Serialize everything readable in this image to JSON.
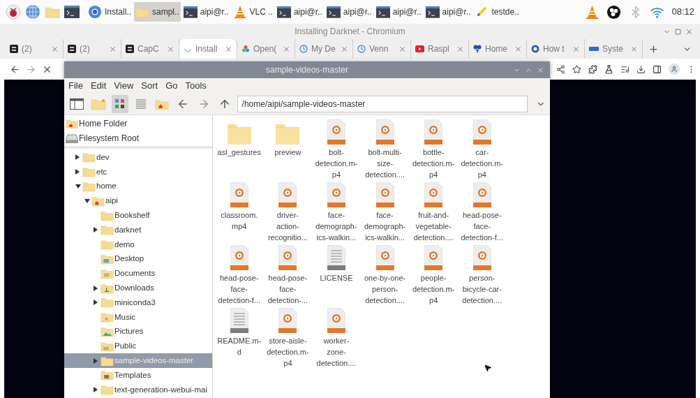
{
  "taskbar": {
    "launchers": [
      {
        "kind": "raspberry"
      },
      {
        "kind": "globe"
      },
      {
        "kind": "folder"
      },
      {
        "kind": "terminal"
      }
    ],
    "tasks": [
      {
        "kind": "chromium",
        "label": "Install..",
        "selected": false
      },
      {
        "kind": "folder",
        "label": "sampl..",
        "selected": true
      },
      {
        "kind": "terminal",
        "label": "aipi@r..",
        "selected": false
      },
      {
        "kind": "vlc",
        "label": "VLC ..",
        "selected": false
      },
      {
        "kind": "terminal",
        "label": "aipi@r..",
        "selected": false
      },
      {
        "kind": "terminal",
        "label": "aipi@r..",
        "selected": false
      },
      {
        "kind": "terminal",
        "label": "aipi@r..",
        "selected": false
      },
      {
        "kind": "terminal",
        "label": "aipi@r..",
        "selected": false
      },
      {
        "kind": "editor",
        "label": "testde..",
        "selected": false
      }
    ],
    "tray": [
      {
        "kind": "vlc"
      },
      {
        "kind": "obs"
      },
      {
        "kind": "bluetooth"
      },
      {
        "kind": "wifi"
      }
    ],
    "clock": "08:12"
  },
  "browser": {
    "title": "Installing Darknet - Chromium",
    "tabs": [
      {
        "kind": "capcut",
        "label": "(2)",
        "selected": false
      },
      {
        "kind": "capcut",
        "label": "(2)",
        "selected": false
      },
      {
        "kind": "capcut",
        "label": "CapC",
        "selected": false
      },
      {
        "kind": "loading",
        "label": "Install",
        "selected": true
      },
      {
        "kind": "colorful",
        "label": "Open(",
        "selected": false
      },
      {
        "kind": "clock",
        "label": "My De",
        "selected": false
      },
      {
        "kind": "clock",
        "label": "Venn",
        "selected": false
      },
      {
        "kind": "video",
        "label": "Raspl",
        "selected": false
      },
      {
        "kind": "shape",
        "label": "Home",
        "selected": false
      },
      {
        "kind": "gear",
        "label": "How t",
        "selected": false
      },
      {
        "kind": "chip",
        "label": "Syste",
        "selected": false
      }
    ]
  },
  "file_manager": {
    "title": "sample-videos-master",
    "menu": [
      "File",
      "Edit",
      "View",
      "Sort",
      "Go",
      "Tools"
    ],
    "toolbar": [
      {
        "kind": "sidepane",
        "selected": false
      },
      {
        "kind": "newfolder",
        "selected": false
      },
      {
        "kind": "icons",
        "selected": true
      },
      {
        "kind": "list",
        "selected": false
      },
      {
        "kind": "home",
        "selected": false
      },
      {
        "kind": "back",
        "selected": false
      },
      {
        "kind": "forward",
        "selected": false
      },
      {
        "kind": "up",
        "selected": false
      }
    ],
    "path": "/home/aipi/sample-videos-master",
    "places": [
      {
        "kind": "home",
        "label": "Home Folder"
      },
      {
        "kind": "drive",
        "label": "Filesystem Root"
      }
    ],
    "tree": [
      {
        "label": "dev",
        "kind": "folder",
        "expanded": false,
        "selected": false
      },
      {
        "label": "etc",
        "kind": "folder",
        "expanded": false,
        "selected": false
      },
      {
        "label": "home",
        "kind": "folder",
        "expanded": true,
        "selected": false,
        "children": [
          {
            "label": "aipi",
            "kind": "home",
            "expanded": true,
            "selected": false,
            "children": [
              {
                "label": "Bookshelf",
                "kind": "folder",
                "selected": false
              },
              {
                "label": "darknet",
                "kind": "folder",
                "expanded": false,
                "selected": false
              },
              {
                "label": "demo",
                "kind": "folder",
                "selected": false
              },
              {
                "label": "Desktop",
                "kind": "desktop",
                "selected": false
              },
              {
                "label": "Documents",
                "kind": "documents",
                "selected": false
              },
              {
                "label": "Downloads",
                "kind": "downloads",
                "expanded": false,
                "selected": false
              },
              {
                "label": "miniconda3",
                "kind": "folder",
                "expanded": false,
                "selected": false
              },
              {
                "label": "Music",
                "kind": "music",
                "selected": false
              },
              {
                "label": "Pictures",
                "kind": "pictures",
                "selected": false
              },
              {
                "label": "Public",
                "kind": "public",
                "selected": false
              },
              {
                "label": "sample-videos-master",
                "kind": "folder",
                "expanded": false,
                "selected": true
              },
              {
                "label": "Templates",
                "kind": "templates",
                "selected": false
              },
              {
                "label": "text-generation-webui-mai",
                "kind": "folder",
                "expanded": false,
                "selected": false
              }
            ]
          }
        ]
      }
    ],
    "files": [
      {
        "kind": "folder",
        "lines": [
          "asl_gestures"
        ]
      },
      {
        "kind": "folder",
        "lines": [
          "preview"
        ]
      },
      {
        "kind": "video",
        "lines": [
          "bolt-",
          "detection.m-",
          "p4"
        ]
      },
      {
        "kind": "video",
        "lines": [
          "bolt-multi-",
          "size-",
          "detection...."
        ]
      },
      {
        "kind": "video",
        "lines": [
          "bottle-",
          "detection.m-",
          "p4"
        ]
      },
      {
        "kind": "video",
        "lines": [
          "car-",
          "detection.m-",
          "p4"
        ]
      },
      {
        "kind": "video",
        "lines": [
          "classroom.",
          "mp4"
        ]
      },
      {
        "kind": "video",
        "lines": [
          "driver-",
          "action-",
          "recognitio..."
        ]
      },
      {
        "kind": "video",
        "lines": [
          "face-",
          "demograph-",
          "ics-walkin..."
        ]
      },
      {
        "kind": "video",
        "lines": [
          "face-",
          "demograph-",
          "ics-walkin..."
        ]
      },
      {
        "kind": "video",
        "lines": [
          "fruit-and-",
          "vegetable-",
          "detection...."
        ]
      },
      {
        "kind": "video",
        "lines": [
          "head-pose-",
          "face-",
          "detection-f..."
        ]
      },
      {
        "kind": "video",
        "lines": [
          "head-pose-",
          "face-",
          "detection-f..."
        ]
      },
      {
        "kind": "video",
        "lines": [
          "head-pose-",
          "face-",
          "detection-..."
        ]
      },
      {
        "kind": "text",
        "lines": [
          "LICENSE"
        ]
      },
      {
        "kind": "video",
        "lines": [
          "one-by-one-",
          "person-",
          "detection...."
        ]
      },
      {
        "kind": "video",
        "lines": [
          "people-",
          "detection.m-",
          "p4"
        ]
      },
      {
        "kind": "video",
        "lines": [
          "person-",
          "bicycle-car-",
          "detection...."
        ]
      },
      {
        "kind": "text",
        "lines": [
          "README.m-",
          "d"
        ]
      },
      {
        "kind": "video",
        "lines": [
          "store-aisle-",
          "detection.m-",
          "p4"
        ]
      },
      {
        "kind": "video",
        "lines": [
          "worker-",
          "zone-",
          "detection...."
        ]
      }
    ]
  }
}
